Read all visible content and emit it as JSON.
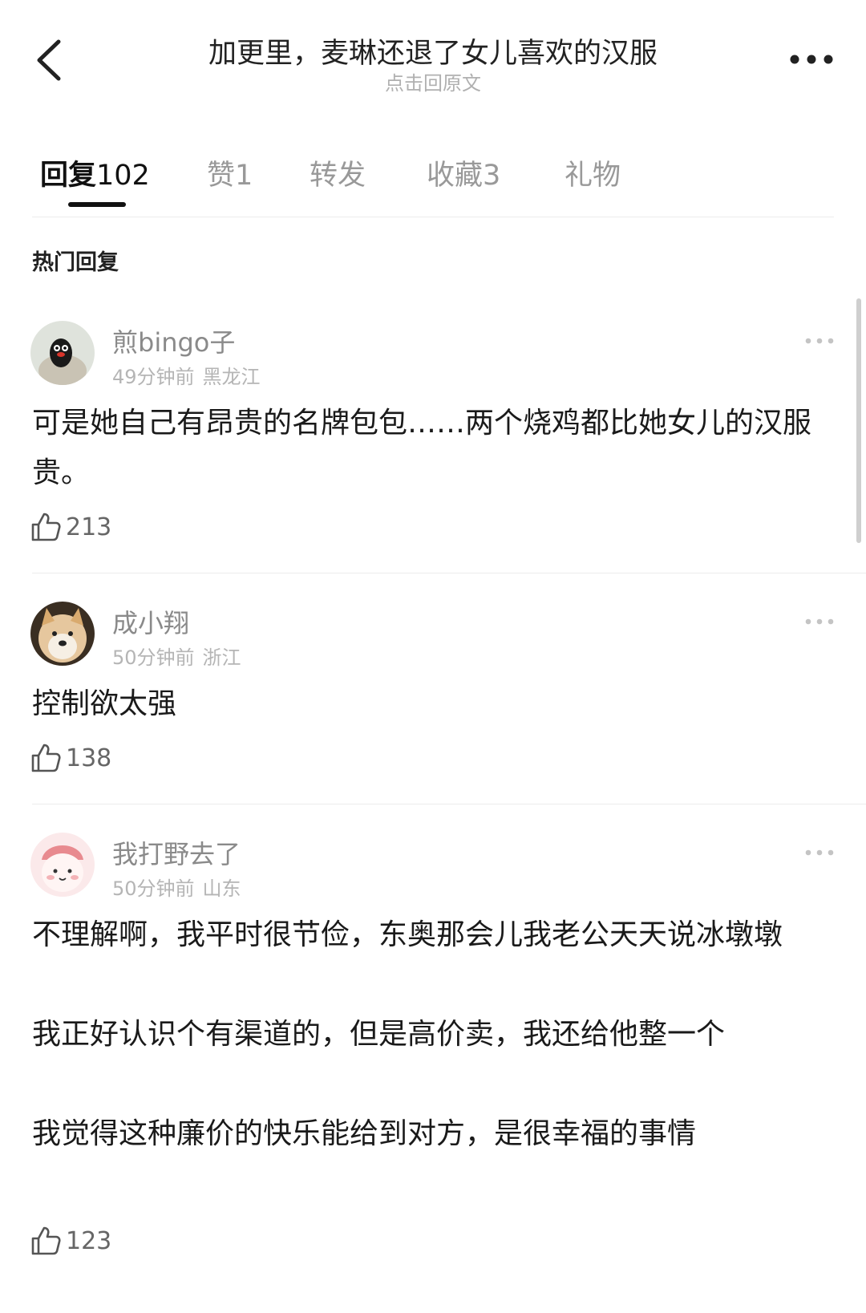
{
  "header": {
    "title": "加更里，麦琳还退了女儿喜欢的汉服",
    "subtitle": "点击回原文"
  },
  "tabs": [
    {
      "label": "回复",
      "count": "102"
    },
    {
      "label": "赞",
      "count": "1"
    },
    {
      "label": "转发",
      "count": ""
    },
    {
      "label": "收藏",
      "count": "3"
    },
    {
      "label": "礼物",
      "count": ""
    }
  ],
  "section_title": "热门回复",
  "comments": [
    {
      "username": "煎bingo子",
      "time": "49分钟前",
      "location": "黑龙江",
      "paragraphs": [
        "可是她自己有昂贵的名牌包包……两个烧鸡都比她女儿的汉服贵。"
      ],
      "likes": "213"
    },
    {
      "username": "成小翔",
      "time": "50分钟前",
      "location": "浙江",
      "paragraphs": [
        "控制欲太强"
      ],
      "likes": "138"
    },
    {
      "username": "我打野去了",
      "time": "50分钟前",
      "location": "山东",
      "paragraphs": [
        "不理解啊，我平时很节俭，东奥那会儿我老公天天说冰墩墩",
        "我正好认识个有渠道的，但是高价卖，我还给他整一个",
        "我觉得这种廉价的快乐能给到对方，是很幸福的事情"
      ],
      "likes": "123"
    }
  ],
  "icons": {
    "back": "chevron-left-icon",
    "more": "more-dots-icon",
    "like": "thumbs-up-icon"
  },
  "colors": {
    "text": "#1a1a1a",
    "muted": "#999999",
    "meta": "#b5b5b5",
    "divider": "#ececec"
  }
}
